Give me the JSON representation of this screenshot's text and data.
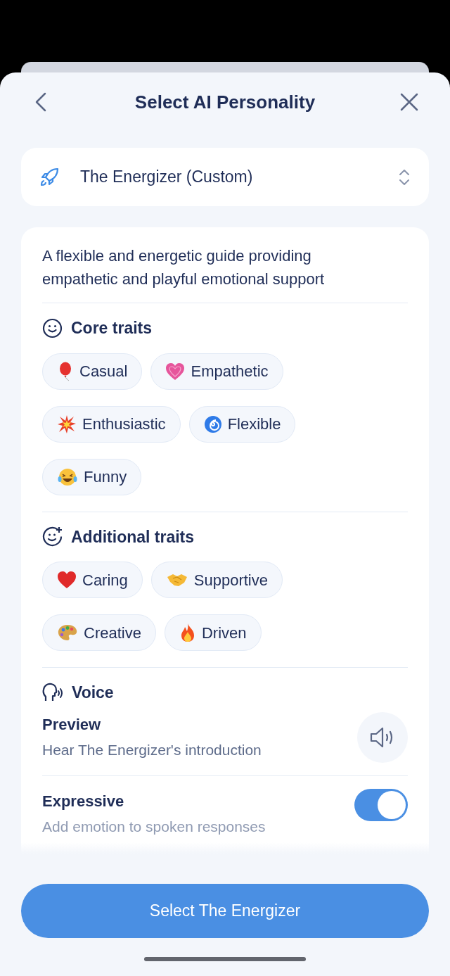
{
  "header": {
    "title": "Select AI Personality"
  },
  "selector": {
    "value": "The Energizer (Custom)"
  },
  "description": "A flexible and energetic guide providing empathetic and playful emotional support",
  "core_traits": {
    "title": "Core traits",
    "chips": [
      {
        "label": "Casual"
      },
      {
        "label": "Empathetic"
      },
      {
        "label": "Enthusiastic"
      },
      {
        "label": "Flexible"
      },
      {
        "label": "Funny"
      }
    ]
  },
  "additional_traits": {
    "title": "Additional traits",
    "chips": [
      {
        "label": "Caring"
      },
      {
        "label": "Supportive"
      },
      {
        "label": "Creative"
      },
      {
        "label": "Driven"
      }
    ]
  },
  "voice": {
    "title": "Voice",
    "preview": {
      "title": "Preview",
      "subtitle": "Hear The Energizer's introduction"
    },
    "expressive": {
      "title": "Expressive",
      "subtitle": "Add emotion to spoken responses",
      "on": true
    }
  },
  "primary_button": "Select The Energizer"
}
